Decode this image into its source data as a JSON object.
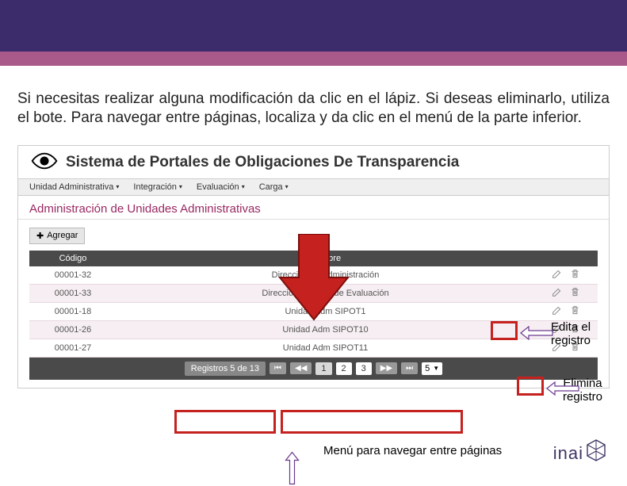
{
  "instruction_text": "Si necesitas realizar alguna modificación da clic en el lápiz. Si deseas eliminarlo, utiliza el bote. Para navegar entre páginas, localiza y da clic en el menú de la parte inferior.",
  "system_title": "Sistema de Portales de Obligaciones De Transparencia",
  "menu": {
    "items": [
      "Unidad Administrativa",
      "Integración",
      "Evaluación",
      "Carga"
    ]
  },
  "section_title": "Administración de Unidades Administrativas",
  "add_button_label": "Agregar",
  "table": {
    "headers": {
      "code": "Código",
      "name": "Nombre",
      "actions": ""
    },
    "rows": [
      {
        "code": "00001-32",
        "name": "Dirección de Administración"
      },
      {
        "code": "00001-33",
        "name": "Dirección General de Evaluación"
      },
      {
        "code": "00001-18",
        "name": "Unidad Adm SIPOT1"
      },
      {
        "code": "00001-26",
        "name": "Unidad Adm SIPOT10"
      },
      {
        "code": "00001-27",
        "name": "Unidad Adm SIPOT11"
      }
    ]
  },
  "pager": {
    "info": "Registros 5 de 13",
    "first": "⏮",
    "prev": "◀◀",
    "pages": [
      "1",
      "2",
      "3"
    ],
    "next": "▶▶",
    "last": "⏭",
    "size": "5",
    "size_caret": "▼"
  },
  "callouts": {
    "edit": "Edita el registro",
    "delete": "Elimina registro",
    "pager": "Menú para navegar entre páginas"
  },
  "logo_text": "inai"
}
